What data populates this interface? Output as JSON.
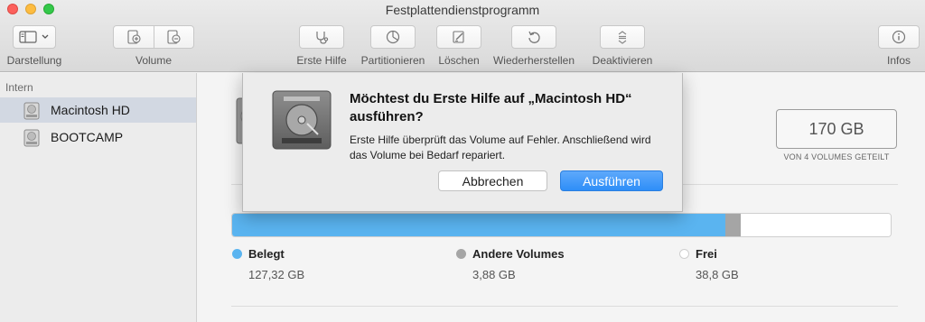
{
  "window": {
    "title": "Festplattendienstprogramm"
  },
  "toolbar": {
    "darstellung": "Darstellung",
    "volume": "Volume",
    "erste_hilfe": "Erste Hilfe",
    "partitionieren": "Partitionieren",
    "loeschen": "Löschen",
    "wiederherstellen": "Wiederherstellen",
    "deaktivieren": "Deaktivieren",
    "infos": "Infos"
  },
  "sidebar": {
    "section_header": "Intern",
    "items": [
      {
        "label": "Macintosh HD",
        "selected": true,
        "icon": "internal-disk-icon"
      },
      {
        "label": "BOOTCAMP",
        "selected": false,
        "icon": "internal-disk-icon"
      }
    ]
  },
  "volume_info": {
    "capacity": "170 GB",
    "capacity_note": "VON 4 VOLUMES GETEILT"
  },
  "usage": {
    "segments": [
      {
        "name": "Belegt",
        "value": "127,32 GB",
        "gb": 127.32,
        "color": "#5ab4f0"
      },
      {
        "name": "Andere Volumes",
        "value": "3,88 GB",
        "gb": 3.88,
        "color": "#a5a5a5"
      },
      {
        "name": "Frei",
        "value": "38,8 GB",
        "gb": 38.8,
        "color": "#ffffff"
      }
    ]
  },
  "dialog": {
    "question": "Möchtest du Erste Hilfe auf „Macintosh HD“ ausführen?",
    "description": "Erste Hilfe überprüft das Volume auf Fehler. Anschließend wird das Volume bei Bedarf repariert.",
    "cancel_label": "Abbrechen",
    "ok_label": "Ausführen",
    "accent_color": "#3a92f8"
  }
}
